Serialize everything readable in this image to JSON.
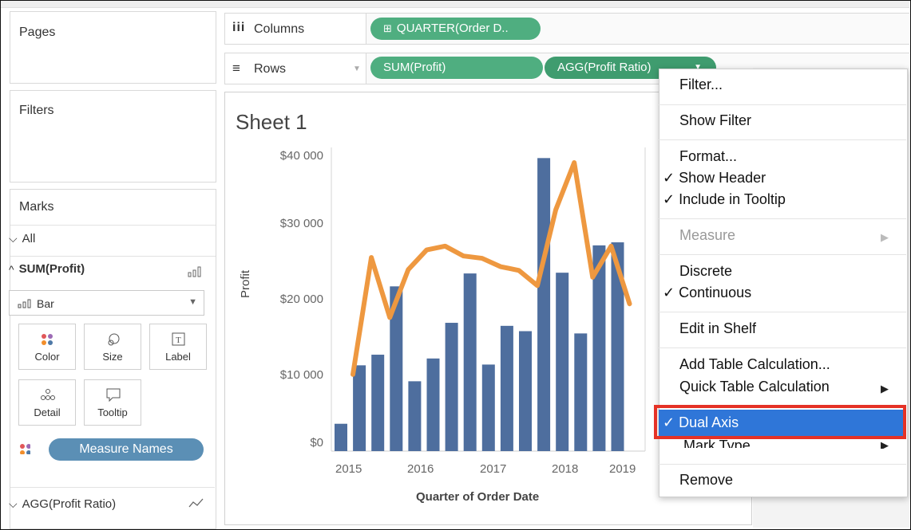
{
  "left": {
    "pages_title": "Pages",
    "filters_title": "Filters",
    "marks_title": "Marks",
    "all_label": "All",
    "sum_profit_label": "SUM(Profit)",
    "mark_type": "Bar",
    "buttons": [
      {
        "label": "Color",
        "icon": "color-dots-icon"
      },
      {
        "label": "Size",
        "icon": "size-icon"
      },
      {
        "label": "Label",
        "icon": "label-icon"
      },
      {
        "label": "Detail",
        "icon": "detail-icon"
      },
      {
        "label": "Tooltip",
        "icon": "tooltip-icon"
      }
    ],
    "measure_names": "Measure Names",
    "agg_profit_ratio": "AGG(Profit Ratio)"
  },
  "shelves": {
    "columns_label": "Columns",
    "rows_label": "Rows",
    "columns_pill": "QUARTER(Order D..",
    "rows_pill_1": "SUM(Profit)",
    "rows_pill_2": "AGG(Profit Ratio)"
  },
  "sheet": {
    "title": "Sheet 1",
    "y_axis_label": "Profit",
    "x_axis_label": "Quarter of Order Date"
  },
  "chart_data": {
    "type": "bar",
    "y_ticks": [
      "$40 000",
      "$30 000",
      "$20 000",
      "$10 000",
      "$0"
    ],
    "x_ticks": [
      "2015",
      "2016",
      "2017",
      "2018",
      "2019"
    ],
    "bars": [
      3600,
      11300,
      12700,
      21700,
      9200,
      12200,
      16900,
      23400,
      11400,
      16500,
      15800,
      38600,
      23500,
      15500,
      27100,
      27500
    ],
    "line": [
      10100,
      25500,
      17600,
      23900,
      26500,
      27000,
      25700,
      25400,
      24300,
      23800,
      21800,
      31800,
      38000,
      22900,
      27000,
      19400
    ],
    "ylim": [
      0,
      40000
    ],
    "bar_color": "#4e6e9e",
    "line_color": "#ee9840"
  },
  "menu": {
    "items": [
      {
        "label": "Filter...",
        "checked": false
      },
      {
        "label": "Show Filter",
        "checked": false
      },
      {
        "label": "Format...",
        "checked": false
      },
      {
        "label": "Show Header",
        "checked": true
      },
      {
        "label": "Include in Tooltip",
        "checked": true
      },
      {
        "label": "Measure",
        "checked": false
      },
      {
        "label": "Discrete",
        "checked": false
      },
      {
        "label": "Continuous",
        "checked": true
      },
      {
        "label": "Edit in Shelf",
        "checked": false
      },
      {
        "label": "Add Table Calculation...",
        "checked": false
      },
      {
        "label": "Quick Table Calculation",
        "checked": false
      },
      {
        "label": "Dual Axis",
        "checked": true
      },
      {
        "label": "Mark Type",
        "checked": false
      },
      {
        "label": "Remove",
        "checked": false
      }
    ],
    "checkmark": "✓",
    "submenu_arrow": "▶"
  }
}
